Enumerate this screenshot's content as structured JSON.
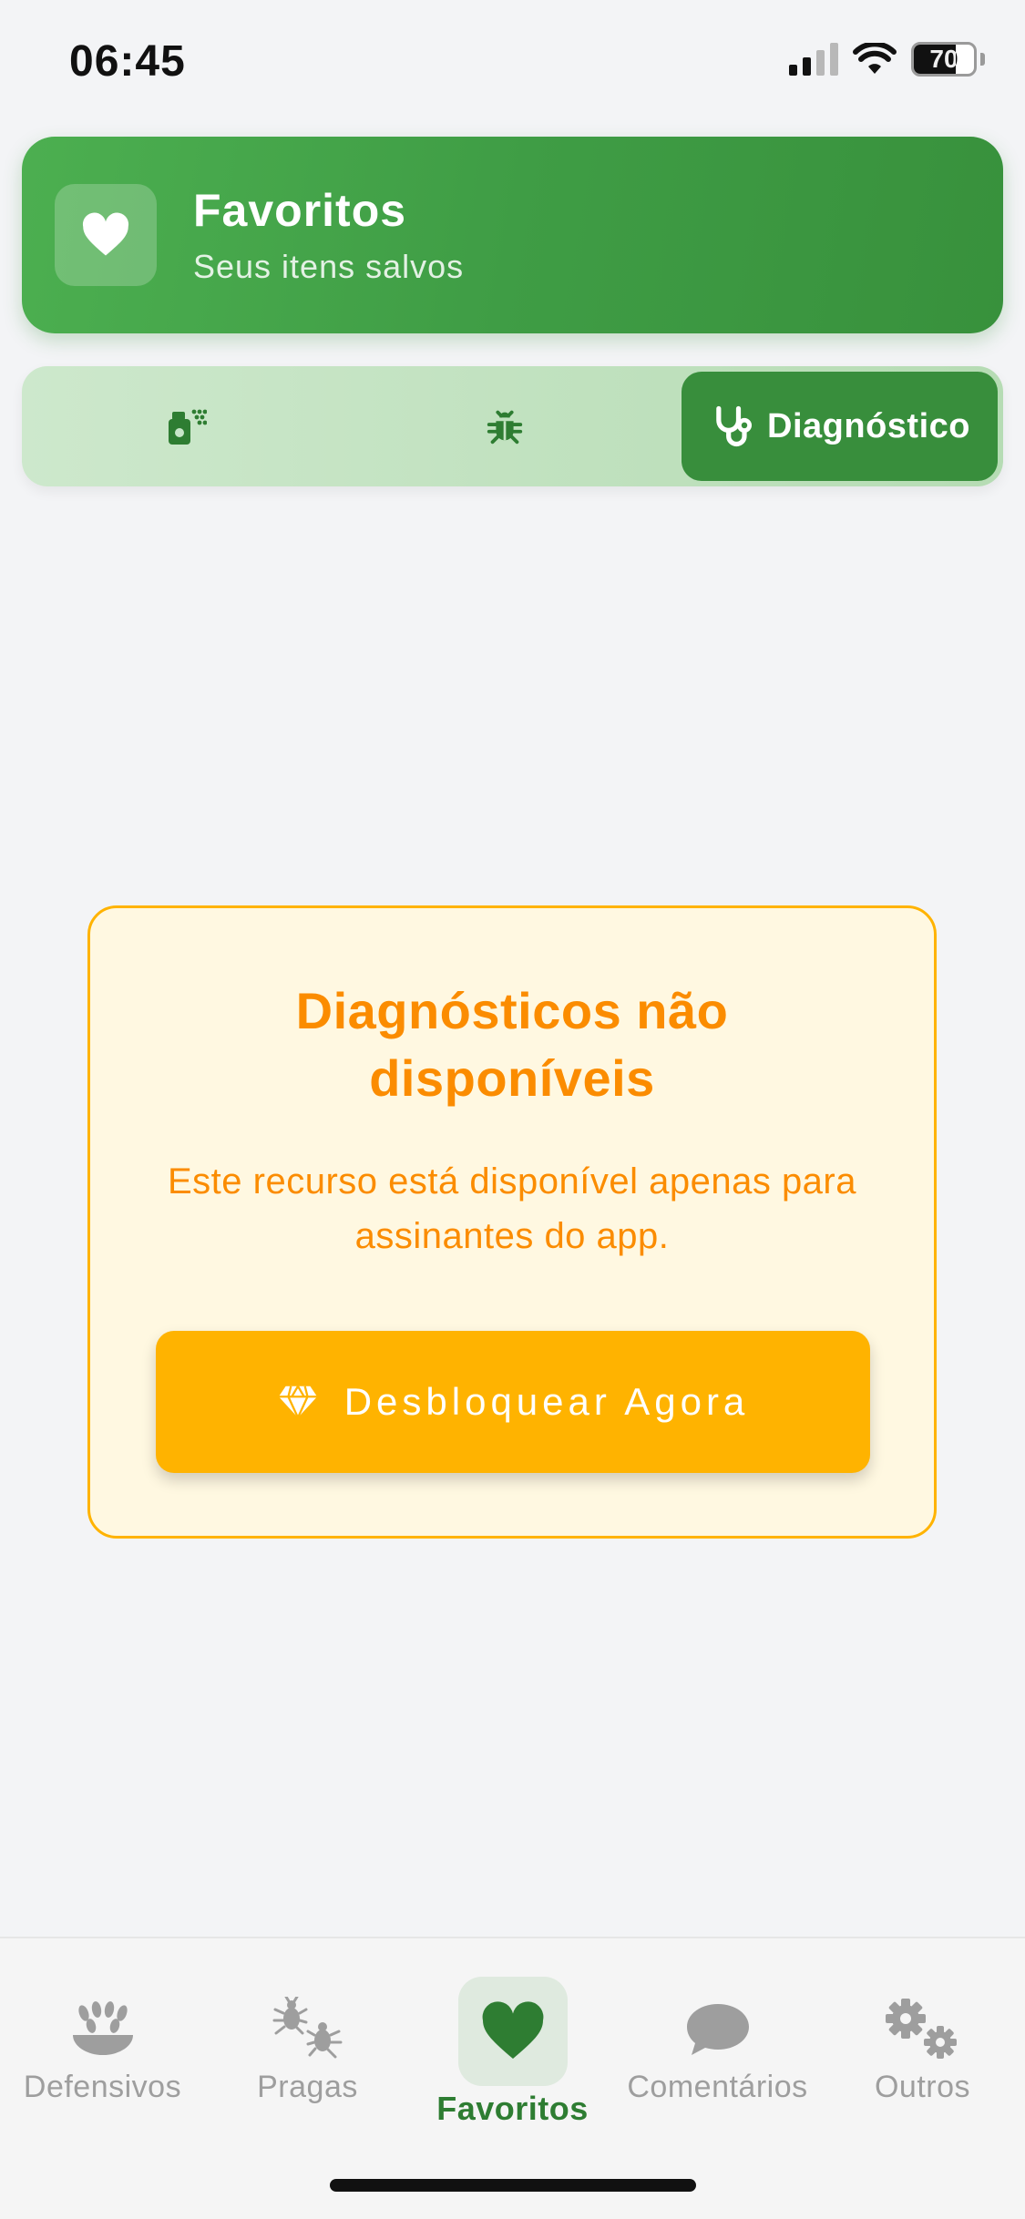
{
  "status_bar": {
    "time": "06:45",
    "battery_level": "70",
    "battery_fraction": 0.7
  },
  "header": {
    "title": "Favoritos",
    "subtitle": "Seus itens salvos",
    "icon": "heart-icon"
  },
  "tabs": [
    {
      "icon": "spray-bottle-icon",
      "label": "",
      "selected": false
    },
    {
      "icon": "bug-icon",
      "label": "",
      "selected": false
    },
    {
      "icon": "stethoscope-icon",
      "label": "Diagnóstico",
      "selected": true
    }
  ],
  "locked_state": {
    "title": "Diagnósticos não disponíveis",
    "message": "Este recurso está disponível apenas para assinantes do app.",
    "button_label": "Desbloquear Agora",
    "button_icon": "diamond-icon"
  },
  "bottom_nav": [
    {
      "label": "Defensivos",
      "icon": "wheat-icon",
      "active": false
    },
    {
      "label": "Pragas",
      "icon": "bugs-icon",
      "active": false
    },
    {
      "label": "Favoritos",
      "icon": "heart-icon",
      "active": true
    },
    {
      "label": "Comentários",
      "icon": "comment-icon",
      "active": false
    },
    {
      "label": "Outros",
      "icon": "gears-icon",
      "active": false
    }
  ],
  "colors": {
    "primary_green": "#388e3c",
    "header_green": "#4caf50",
    "warning_orange": "#fb8c00",
    "amber": "#ffb300",
    "card_bg": "#fff8e1",
    "inactive_gray": "#9e9e9e",
    "active_nav_green": "#2e7d32"
  }
}
